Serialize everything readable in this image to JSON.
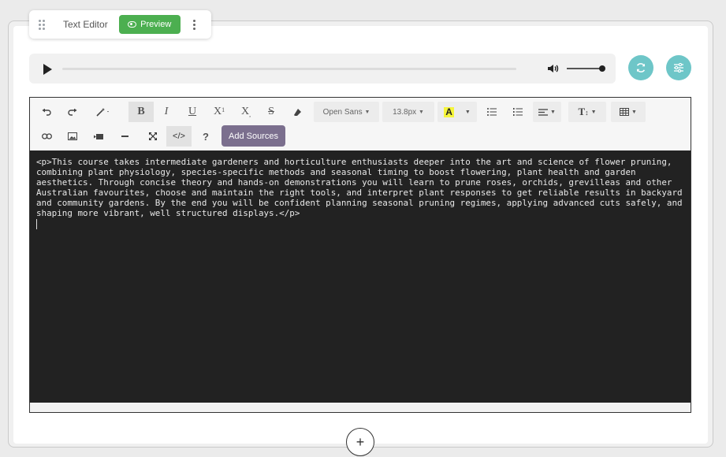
{
  "widget": {
    "title": "Text Editor",
    "preview_label": "Preview"
  },
  "colors": {
    "preview": "#4caf50",
    "teal": "#6ec6c8",
    "add_sources": "#7b6f8e",
    "code_bg": "#222222"
  },
  "toolbar": {
    "font_family": "Open Sans",
    "font_size": "13.8px",
    "add_sources_label": "Add Sources",
    "bold": "B",
    "italic": "I",
    "underline": "U",
    "superscript": "X",
    "subscript": "X",
    "strike": "S",
    "help": "?",
    "code_view": "</>"
  },
  "code_content": "<p>This course takes intermediate gardeners and horticulture enthusiasts deeper into the art and science of flower pruning, combining plant physiology, species-specific methods and seasonal timing to boost flowering, plant health and garden aesthetics. Through concise theory and hands-on demonstrations you will learn to prune roses, orchids, grevilleas and other Australian favourites, choose and maintain the right tools, and interpret plant responses to get reliable results in backyard and community gardens. By the end you will be confident planning seasonal pruning regimes, applying advanced cuts safely, and shaping more vibrant, well structured displays.</p>"
}
